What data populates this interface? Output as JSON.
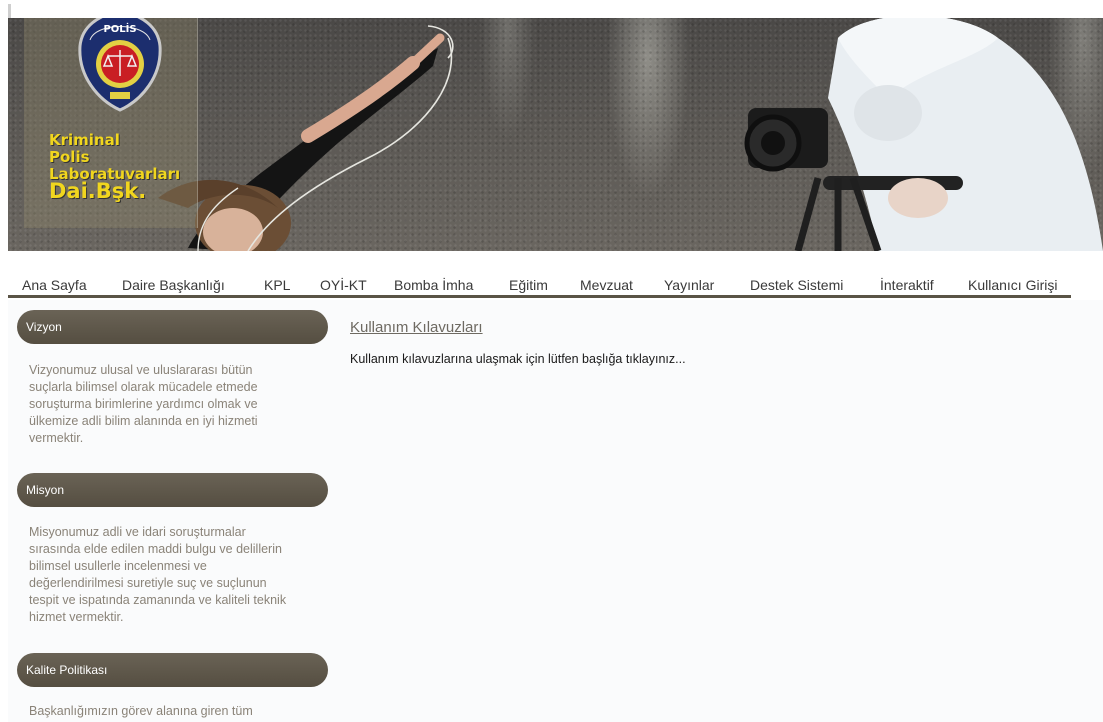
{
  "logo": {
    "badge_text": "POLİS",
    "line1": "Kriminal",
    "line2": "Polis",
    "line3": "Laboratuvarları",
    "line4": "Dai.Bşk."
  },
  "nav": {
    "items": [
      "Ana Sayfa",
      "Daire Başkanlığı",
      "KPL",
      "OYİ-KT",
      "Bomba İmha",
      "Eğitim",
      "Mevzuat",
      "Yayınlar",
      "Destek Sistemi",
      "İnteraktif",
      "Kullanıcı Girişi"
    ]
  },
  "sidebar": {
    "sections": [
      {
        "title": "Vizyon",
        "lines": [
          "Vizyonumuz ulusal ve uluslararası bütün",
          "suçlarla bilimsel olarak mücadele etmede",
          "soruşturma birimlerine yardımcı olmak ve",
          "ülkemize adli bilim alanında en iyi hizmeti",
          "vermektir."
        ]
      },
      {
        "title": "Misyon",
        "lines": [
          "Misyonumuz adli ve idari soruşturmalar",
          "sırasında elde edilen maddi bulgu ve delillerin",
          "bilimsel usullerle incelenmesi ve",
          "değerlendirilmesi suretiyle suç ve suçlunun",
          "tespit ve ispatında zamanında ve kaliteli teknik",
          "hizmet vermektir."
        ]
      },
      {
        "title": "Kalite Politikası",
        "lines": [
          "Başkanlığımızın görev alanına giren tüm"
        ]
      }
    ]
  },
  "main": {
    "title": "Kullanım Kılavuzları",
    "description": "Kullanım kılavuzlarına ulaşmak için lütfen başlığa tıklayınız..."
  },
  "colors": {
    "nav_underline": "#5a5446",
    "sidebar_header": "#5f584b",
    "logo_text": "#f1d61e"
  }
}
